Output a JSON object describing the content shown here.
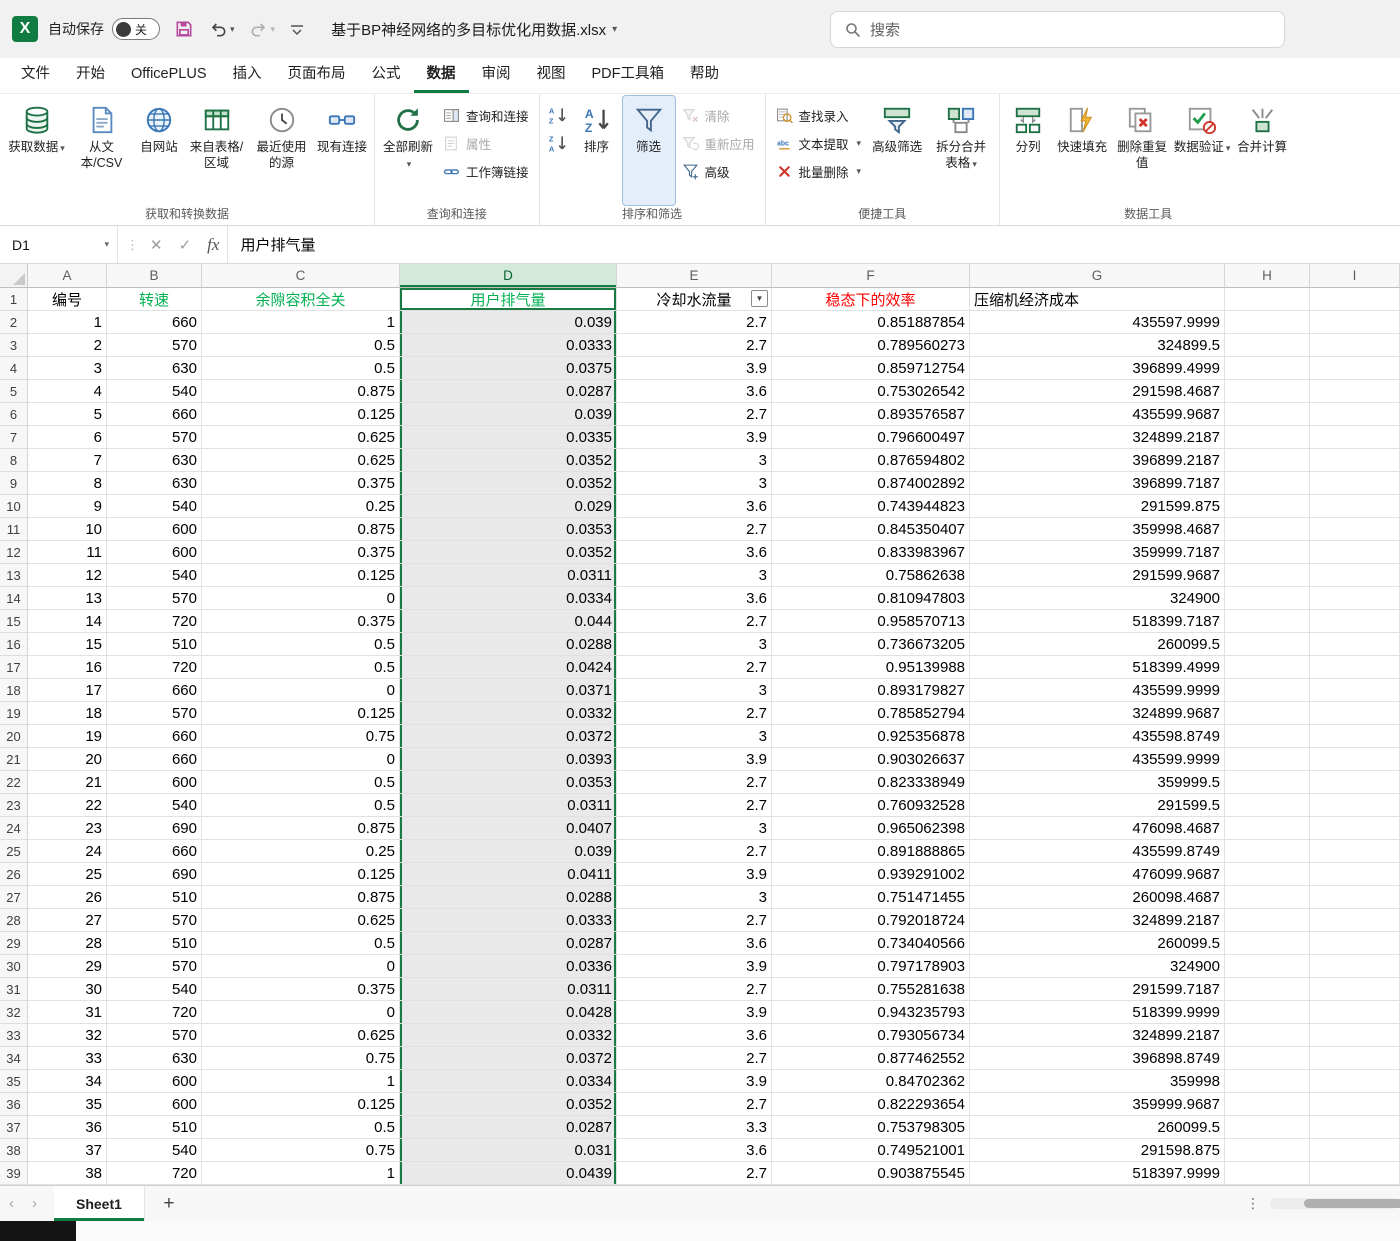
{
  "titlebar": {
    "autosave_label": "自动保存",
    "autosave_state": "关",
    "doc_title": "基于BP神经网络的多目标优化用数据.xlsx",
    "search_placeholder": "搜索"
  },
  "menu": {
    "tabs": [
      "文件",
      "开始",
      "OfficePLUS",
      "插入",
      "页面布局",
      "公式",
      "数据",
      "审阅",
      "视图",
      "PDF工具箱",
      "帮助"
    ],
    "active": "数据"
  },
  "ribbon": {
    "get_group": {
      "label": "获取和转换数据",
      "get_data": "获取数据",
      "from_text": "从文本/CSV",
      "from_web": "自网站",
      "from_table": "来自表格/区域",
      "recent_sources": "最近使用的源",
      "existing_connections": "现有连接"
    },
    "query_group": {
      "label": "查询和连接",
      "refresh_all": "全部刷新",
      "queries": "查询和连接",
      "properties": "属性",
      "workbook_links": "工作簿链接"
    },
    "sort_group": {
      "label": "排序和筛选",
      "sort": "排序",
      "filter": "筛选",
      "clear": "清除",
      "reapply": "重新应用",
      "advanced": "高级"
    },
    "tools_group": {
      "label": "便捷工具",
      "find_entry": "查找录入",
      "text_extract": "文本提取",
      "batch_delete": "批量删除",
      "advanced_filter": "高级筛选",
      "split_merge": "拆分合并表格"
    },
    "data_tools_group": {
      "label": "数据工具",
      "text_to_columns": "分列",
      "flash_fill": "快速填充",
      "remove_duplicates": "删除重复值",
      "data_validation": "数据验证",
      "consolidate": "合并计算"
    }
  },
  "formula_bar": {
    "name_box": "D1",
    "fx_label": "fx",
    "content": "用户排气量"
  },
  "sheet": {
    "column_letters": [
      "A",
      "B",
      "C",
      "D",
      "E",
      "F",
      "G",
      "H",
      "I"
    ],
    "selected_column": "D",
    "active_cell": "D1",
    "filter_column": "E",
    "header_cells": [
      {
        "text": "编号",
        "color": "#000000",
        "align": "center"
      },
      {
        "text": "转速",
        "color": "#00b050",
        "align": "center"
      },
      {
        "text": "余隙容积全关",
        "color": "#00b050",
        "align": "center"
      },
      {
        "text": "用户排气量",
        "color": "#00b050",
        "align": "center"
      },
      {
        "text": "冷却水流量",
        "color": "#000000",
        "align": "center"
      },
      {
        "text": "稳态下的效率",
        "color": "#ff0000",
        "align": "center"
      },
      {
        "text": "压缩机经济成本",
        "color": "#000000",
        "align": "left"
      }
    ],
    "rows": [
      [
        "1",
        "660",
        "1",
        "0.039",
        "2.7",
        "0.851887854",
        "435597.9999"
      ],
      [
        "2",
        "570",
        "0.5",
        "0.0333",
        "2.7",
        "0.789560273",
        "324899.5"
      ],
      [
        "3",
        "630",
        "0.5",
        "0.0375",
        "3.9",
        "0.859712754",
        "396899.4999"
      ],
      [
        "4",
        "540",
        "0.875",
        "0.0287",
        "3.6",
        "0.753026542",
        "291598.4687"
      ],
      [
        "5",
        "660",
        "0.125",
        "0.039",
        "2.7",
        "0.893576587",
        "435599.9687"
      ],
      [
        "6",
        "570",
        "0.625",
        "0.0335",
        "3.9",
        "0.796600497",
        "324899.2187"
      ],
      [
        "7",
        "630",
        "0.625",
        "0.0352",
        "3",
        "0.876594802",
        "396899.2187"
      ],
      [
        "8",
        "630",
        "0.375",
        "0.0352",
        "3",
        "0.874002892",
        "396899.7187"
      ],
      [
        "9",
        "540",
        "0.25",
        "0.029",
        "3.6",
        "0.743944823",
        "291599.875"
      ],
      [
        "10",
        "600",
        "0.875",
        "0.0353",
        "2.7",
        "0.845350407",
        "359998.4687"
      ],
      [
        "11",
        "600",
        "0.375",
        "0.0352",
        "3.6",
        "0.833983967",
        "359999.7187"
      ],
      [
        "12",
        "540",
        "0.125",
        "0.0311",
        "3",
        "0.75862638",
        "291599.9687"
      ],
      [
        "13",
        "570",
        "0",
        "0.0334",
        "3.6",
        "0.810947803",
        "324900"
      ],
      [
        "14",
        "720",
        "0.375",
        "0.044",
        "2.7",
        "0.958570713",
        "518399.7187"
      ],
      [
        "15",
        "510",
        "0.5",
        "0.0288",
        "3",
        "0.736673205",
        "260099.5"
      ],
      [
        "16",
        "720",
        "0.5",
        "0.0424",
        "2.7",
        "0.95139988",
        "518399.4999"
      ],
      [
        "17",
        "660",
        "0",
        "0.0371",
        "3",
        "0.893179827",
        "435599.9999"
      ],
      [
        "18",
        "570",
        "0.125",
        "0.0332",
        "2.7",
        "0.785852794",
        "324899.9687"
      ],
      [
        "19",
        "660",
        "0.75",
        "0.0372",
        "3",
        "0.925356878",
        "435598.8749"
      ],
      [
        "20",
        "660",
        "0",
        "0.0393",
        "3.9",
        "0.903026637",
        "435599.9999"
      ],
      [
        "21",
        "600",
        "0.5",
        "0.0353",
        "2.7",
        "0.823338949",
        "359999.5"
      ],
      [
        "22",
        "540",
        "0.5",
        "0.0311",
        "2.7",
        "0.760932528",
        "291599.5"
      ],
      [
        "23",
        "690",
        "0.875",
        "0.0407",
        "3",
        "0.965062398",
        "476098.4687"
      ],
      [
        "24",
        "660",
        "0.25",
        "0.039",
        "2.7",
        "0.891888865",
        "435599.8749"
      ],
      [
        "25",
        "690",
        "0.125",
        "0.0411",
        "3.9",
        "0.939291002",
        "476099.9687"
      ],
      [
        "26",
        "510",
        "0.875",
        "0.0288",
        "3",
        "0.751471455",
        "260098.4687"
      ],
      [
        "27",
        "570",
        "0.625",
        "0.0333",
        "2.7",
        "0.792018724",
        "324899.2187"
      ],
      [
        "28",
        "510",
        "0.5",
        "0.0287",
        "3.6",
        "0.734040566",
        "260099.5"
      ],
      [
        "29",
        "570",
        "0",
        "0.0336",
        "3.9",
        "0.797178903",
        "324900"
      ],
      [
        "30",
        "540",
        "0.375",
        "0.0311",
        "2.7",
        "0.755281638",
        "291599.7187"
      ],
      [
        "31",
        "720",
        "0",
        "0.0428",
        "3.9",
        "0.943235793",
        "518399.9999"
      ],
      [
        "32",
        "570",
        "0.625",
        "0.0332",
        "3.6",
        "0.793056734",
        "324899.2187"
      ],
      [
        "33",
        "630",
        "0.75",
        "0.0372",
        "2.7",
        "0.877462552",
        "396898.8749"
      ],
      [
        "34",
        "600",
        "1",
        "0.0334",
        "3.9",
        "0.84702362",
        "359998"
      ],
      [
        "35",
        "600",
        "0.125",
        "0.0352",
        "2.7",
        "0.822293654",
        "359999.9687"
      ],
      [
        "36",
        "510",
        "0.5",
        "0.0287",
        "3.3",
        "0.753798305",
        "260099.5"
      ],
      [
        "37",
        "540",
        "0.75",
        "0.031",
        "3.6",
        "0.749521001",
        "291598.875"
      ],
      [
        "38",
        "720",
        "1",
        "0.0439",
        "2.7",
        "0.903875545",
        "518397.9999"
      ]
    ],
    "sheet_tab": "Sheet1",
    "new_sheet_label": "+"
  },
  "colors": {
    "accent_green": "#107c41",
    "selection_fill": "#e9e9e9",
    "header_green": "#00b050",
    "header_red": "#ff0000"
  }
}
